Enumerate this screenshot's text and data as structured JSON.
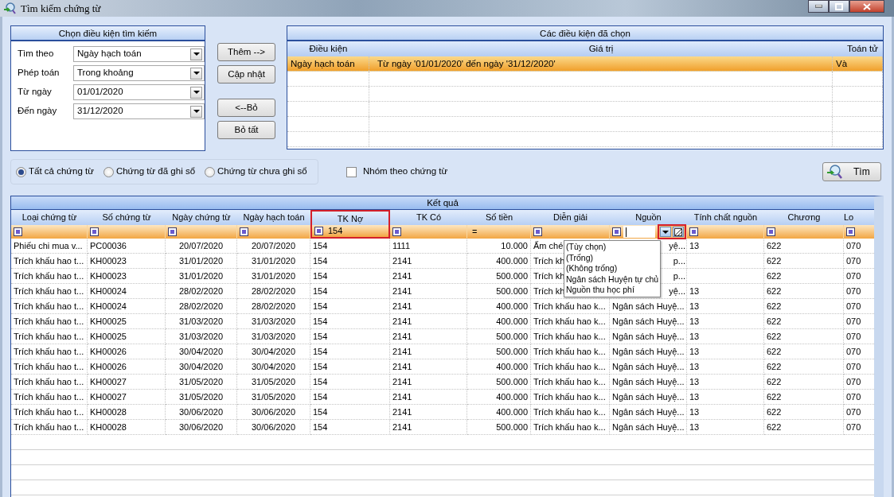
{
  "window": {
    "title": "Tìm kiếm chứng từ"
  },
  "criteria_panel": {
    "title": "Chọn điều kiện tìm kiếm",
    "fields": [
      {
        "label": "Tìm theo",
        "value": "Ngày hạch toán"
      },
      {
        "label": "Phép toán",
        "value": "Trong khoảng"
      },
      {
        "label": "Từ ngày",
        "value": "01/01/2020"
      },
      {
        "label": "Đến ngày",
        "value": "31/12/2020"
      }
    ]
  },
  "action_buttons": [
    "Thêm -->",
    "Cập nhật",
    "<--Bỏ",
    "Bỏ tất"
  ],
  "selected_conditions": {
    "title": "Các điều kiện đã chọn",
    "columns": [
      "Điều kiện",
      "Giá trị",
      "Toán tử"
    ],
    "rows": [
      {
        "cells": [
          "Ngày hạch toán",
          "Từ ngày '01/01/2020' đến ngày '31/12/2020'",
          "Và"
        ],
        "selected": true
      }
    ]
  },
  "voucher_filter": [
    {
      "label": "Tất cả chứng từ",
      "selected": true
    },
    {
      "label": "Chứng từ đã ghi sổ",
      "selected": false
    },
    {
      "label": "Chứng từ chưa ghi sổ",
      "selected": false
    }
  ],
  "group_checkbox": {
    "label": "Nhóm theo chứng từ",
    "checked": false
  },
  "search_button": "Tìm",
  "results": {
    "title": "Kết quả",
    "columns": [
      {
        "label": "Loại chứng từ",
        "kind": "text",
        "highlighted": false,
        "filter": {
          "kind": "icon"
        }
      },
      {
        "label": "Số chứng từ",
        "kind": "text",
        "highlighted": false,
        "filter": {
          "kind": "icon"
        }
      },
      {
        "label": "Ngày chứng từ",
        "kind": "date",
        "highlighted": false,
        "filter": {
          "kind": "icon"
        }
      },
      {
        "label": "Ngày hạch toán",
        "kind": "date",
        "highlighted": false,
        "filter": {
          "kind": "icon"
        }
      },
      {
        "label": "TK Nợ",
        "kind": "text",
        "highlighted": true,
        "filter": {
          "kind": "icon",
          "value": "154"
        }
      },
      {
        "label": "TK Có",
        "kind": "text",
        "highlighted": false,
        "filter": {
          "kind": "icon"
        }
      },
      {
        "label": "Số tiền",
        "kind": "money",
        "highlighted": false,
        "filter": {
          "kind": "symbol",
          "symbol": "="
        }
      },
      {
        "label": "Diễn giải",
        "kind": "text",
        "highlighted": false,
        "filter": {
          "kind": "icon"
        }
      },
      {
        "label": "Nguồn",
        "kind": "text",
        "highlighted": true,
        "filter": {
          "kind": "editing",
          "options": [
            "(Tùy chọn)",
            "(Trống)",
            "(Không trống)",
            "Ngân sách Huyện tự chủ",
            "Nguồn thu học phí"
          ]
        }
      },
      {
        "label": "Tính chất nguồn",
        "kind": "text",
        "highlighted": false,
        "filter": {
          "kind": "icon"
        }
      },
      {
        "label": "Chương",
        "kind": "text",
        "highlighted": false,
        "filter": {
          "kind": "icon"
        }
      },
      {
        "label": "Lo",
        "kind": "text",
        "highlighted": false,
        "filter": {
          "kind": "icon"
        }
      }
    ],
    "rows": [
      {
        "covered": true,
        "cells": [
          "Phiếu chi mua v...",
          "PC00036",
          "20/07/2020",
          "20/07/2020",
          "154",
          "1111",
          "10.000",
          "Ấm ché",
          "yệ...",
          "13",
          "622",
          "070"
        ]
      },
      {
        "covered": true,
        "cells": [
          "Trích khấu hao t...",
          "KH00023",
          "31/01/2020",
          "31/01/2020",
          "154",
          "2141",
          "400.000",
          "Trích kh",
          "p...",
          null,
          "622",
          "070"
        ]
      },
      {
        "covered": true,
        "cells": [
          "Trích khấu hao t...",
          "KH00023",
          "31/01/2020",
          "31/01/2020",
          "154",
          "2141",
          "500.000",
          "Trích kh",
          "p...",
          null,
          "622",
          "070"
        ]
      },
      {
        "covered": true,
        "cells": [
          "Trích khấu hao t...",
          "KH00024",
          "28/02/2020",
          "28/02/2020",
          "154",
          "2141",
          "500.000",
          "Trích kh",
          "yệ...",
          "13",
          "622",
          "070"
        ]
      },
      {
        "covered": false,
        "cells": [
          "Trích khấu hao t...",
          "KH00024",
          "28/02/2020",
          "28/02/2020",
          "154",
          "2141",
          "400.000",
          "Trích khấu hao k...",
          "Ngân sách Huyệ...",
          "13",
          "622",
          "070"
        ]
      },
      {
        "covered": false,
        "cells": [
          "Trích khấu hao t...",
          "KH00025",
          "31/03/2020",
          "31/03/2020",
          "154",
          "2141",
          "400.000",
          "Trích khấu hao k...",
          "Ngân sách Huyệ...",
          "13",
          "622",
          "070"
        ]
      },
      {
        "covered": false,
        "cells": [
          "Trích khấu hao t...",
          "KH00025",
          "31/03/2020",
          "31/03/2020",
          "154",
          "2141",
          "500.000",
          "Trích khấu hao k...",
          "Ngân sách Huyệ...",
          "13",
          "622",
          "070"
        ]
      },
      {
        "covered": false,
        "cells": [
          "Trích khấu hao t...",
          "KH00026",
          "30/04/2020",
          "30/04/2020",
          "154",
          "2141",
          "500.000",
          "Trích khấu hao k...",
          "Ngân sách Huyệ...",
          "13",
          "622",
          "070"
        ]
      },
      {
        "covered": false,
        "cells": [
          "Trích khấu hao t...",
          "KH00026",
          "30/04/2020",
          "30/04/2020",
          "154",
          "2141",
          "400.000",
          "Trích khấu hao k...",
          "Ngân sách Huyệ...",
          "13",
          "622",
          "070"
        ]
      },
      {
        "covered": false,
        "cells": [
          "Trích khấu hao t...",
          "KH00027",
          "31/05/2020",
          "31/05/2020",
          "154",
          "2141",
          "500.000",
          "Trích khấu hao k...",
          "Ngân sách Huyệ...",
          "13",
          "622",
          "070"
        ]
      },
      {
        "covered": false,
        "cells": [
          "Trích khấu hao t...",
          "KH00027",
          "31/05/2020",
          "31/05/2020",
          "154",
          "2141",
          "400.000",
          "Trích khấu hao k...",
          "Ngân sách Huyệ...",
          "13",
          "622",
          "070"
        ]
      },
      {
        "covered": false,
        "cells": [
          "Trích khấu hao t...",
          "KH00028",
          "30/06/2020",
          "30/06/2020",
          "154",
          "2141",
          "400.000",
          "Trích khấu hao k...",
          "Ngân sách Huyệ...",
          "13",
          "622",
          "070"
        ]
      },
      {
        "covered": false,
        "cells": [
          "Trích khấu hao t...",
          "KH00028",
          "30/06/2020",
          "30/06/2020",
          "154",
          "2141",
          "500.000",
          "Trích khấu hao k...",
          "Ngân sách Huyệ...",
          "13",
          "622",
          "070"
        ]
      }
    ]
  }
}
